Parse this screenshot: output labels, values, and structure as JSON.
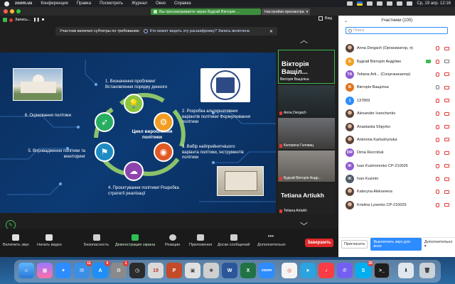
{
  "menubar": {
    "app": "zoom.us",
    "items": [
      "Конференция",
      "Правка",
      "Посмотреть",
      "Журнал",
      "Окно",
      "Справка"
    ],
    "clock": "Ср, 19 апр. 12:16"
  },
  "window": {
    "share_banner": "Вы просматриваете экран Будгай Вікторія ...",
    "share_settings": "Настройки просмотра",
    "recording_label": "Запись...",
    "view_label": "Вид",
    "subtitle_notice": "Участник включил субтитры по требованию",
    "subtitle_link": "Кто может видеть эту расшифровку? Запись включена"
  },
  "slide": {
    "cycle_center": "Цикл вироблення політики",
    "steps": [
      "1. Визначення проблеми/ Встановлення порядку денного",
      "2. Розробка альтернативних варіантів політики/ Формулювання політики",
      "3. Вибір найприйнятнішого варіанта політики, інструментів політики",
      "4. Проєктування політики/ Розробка стратегії реалізації",
      "5. Впровадження політики та моніторинг",
      "6. Оцінювання політики"
    ]
  },
  "speakers": [
    {
      "name": "Вікторія Ващіл...",
      "caption": "Вікторія Ващіліна"
    },
    {
      "caption": "Anna Dergach"
    },
    {
      "caption": "Катерина Головац"
    },
    {
      "caption": "Будгай Вікторія Андр..."
    },
    {
      "name": "Tetiana Artiukh",
      "caption": "Tetiana Artiukh"
    }
  ],
  "toolbar": {
    "items": [
      "Включить звук",
      "Начать видео",
      "Безопасность",
      "Демонстрация экрана",
      "Реакции",
      "Приложения",
      "Доски сообщений",
      "Дополнительно"
    ],
    "end": "Завершить"
  },
  "panel": {
    "title": "Участники (100)",
    "search_placeholder": "Поиск",
    "participants": [
      {
        "name": "Anna Dergach  (Организатор, я)",
        "initial": "",
        "color": "photo",
        "mic": "off",
        "cam": "off"
      },
      {
        "name": "Будгай Вікторія Андріївн",
        "initial": "Б",
        "color": "#f0a020",
        "mic": "off",
        "cam": "on",
        "cc": true
      },
      {
        "name": "Tetiana Arti... (Соорганизатор)",
        "initial": "TA",
        "color": "#8e5bd0",
        "mic": "off",
        "cam": "off"
      },
      {
        "name": "Вікторія Ващіліна",
        "initial": "В",
        "color": "#e2731c",
        "mic": "on",
        "cam": "off"
      },
      {
        "name": "137869",
        "initial": "1",
        "color": "#2d8cff",
        "mic": "off",
        "cam": "off"
      },
      {
        "name": "Alexander Ivanchenko",
        "initial": "",
        "color": "photo",
        "mic": "off",
        "cam": "off"
      },
      {
        "name": "Anastasiia Shpyrko",
        "initial": "",
        "color": "photo",
        "mic": "off",
        "cam": "off"
      },
      {
        "name": "Antonina Kartushynska",
        "initial": "",
        "color": "photo",
        "mic": "off",
        "cam": "off"
      },
      {
        "name": "Dima Recrotiuk",
        "initial": "DR",
        "color": "#8e5bd0",
        "mic": "off",
        "cam": "off"
      },
      {
        "name": "Ivan Kushnirenko СР-210025",
        "initial": "IK",
        "color": "#8e5bd0",
        "mic": "off",
        "cam": "off"
      },
      {
        "name": "Ivan Kuzmin",
        "initial": "IK",
        "color": "#4f5a66",
        "mic": "off",
        "cam": "off"
      },
      {
        "name": "Kateryna Alekseieva",
        "initial": "",
        "color": "photo",
        "mic": "off",
        "cam": "off"
      },
      {
        "name": "Kristina Lysenko СР-210025",
        "initial": "",
        "color": "photo",
        "mic": "off",
        "cam": "off"
      }
    ],
    "invite": "Пригласить",
    "unmute_all": "Выключить звук для всех",
    "more": "Дополнительно"
  },
  "dock": {
    "badges": {
      "mail": "11",
      "appstore": "6",
      "settings": "1",
      "skype": "20"
    }
  }
}
